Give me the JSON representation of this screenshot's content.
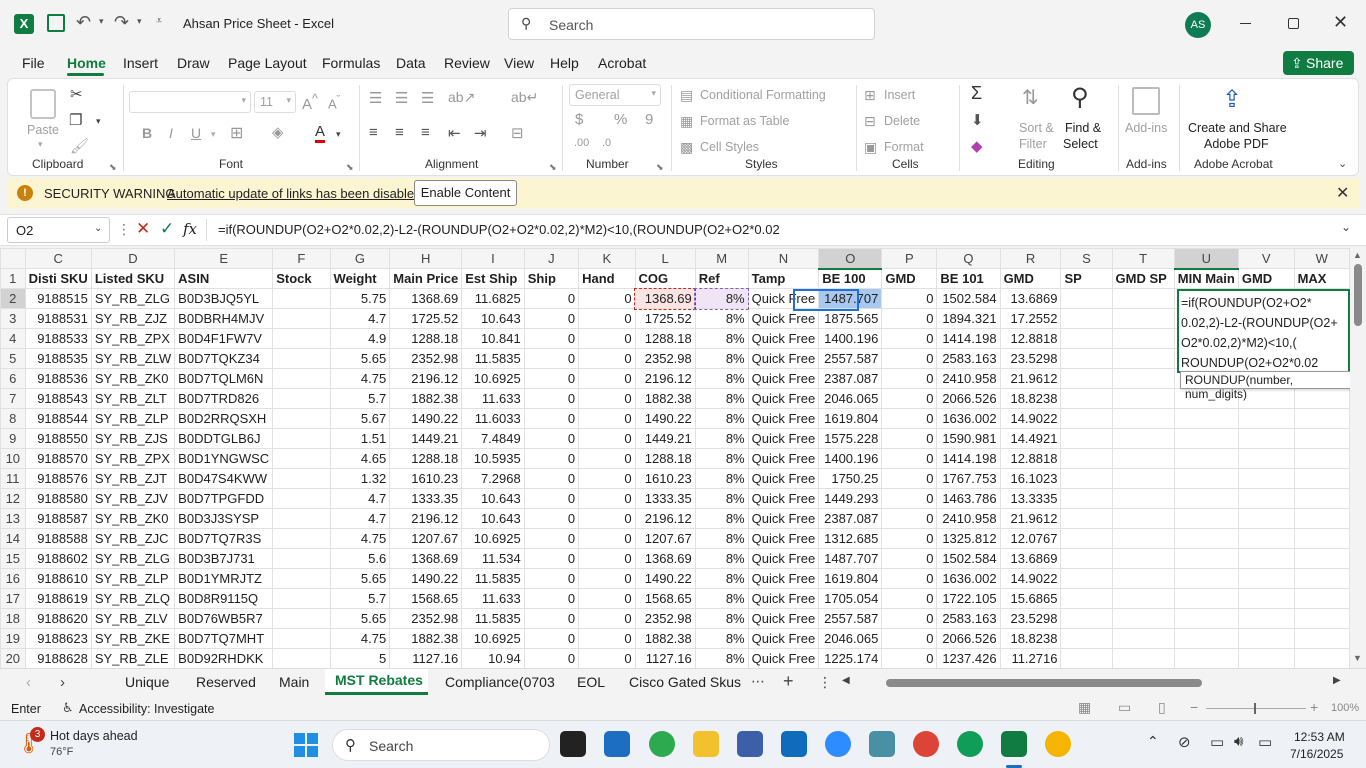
{
  "window": {
    "title": "Ahsan Price Sheet  -  Excel",
    "search_placeholder": "Search",
    "avatar": "AS"
  },
  "menu": [
    "File",
    "Home",
    "Insert",
    "Draw",
    "Page Layout",
    "Formulas",
    "Data",
    "Review",
    "View",
    "Help",
    "Acrobat"
  ],
  "share_label": "Share",
  "ribbon": {
    "clipboard": {
      "paste": "Paste",
      "group": "Clipboard"
    },
    "font": {
      "size": "11",
      "group": "Font"
    },
    "alignment": {
      "group": "Alignment"
    },
    "number": {
      "format": "General",
      "group": "Number"
    },
    "styles": {
      "cond": "Conditional Formatting",
      "table": "Format as Table",
      "cell": "Cell Styles",
      "group": "Styles"
    },
    "cells": {
      "insert": "Insert",
      "delete": "Delete",
      "format": "Format",
      "group": "Cells"
    },
    "editing": {
      "sort": "Sort &",
      "filter": "Filter",
      "find": "Find &",
      "select": "Select",
      "group": "Editing"
    },
    "addins": {
      "btn": "Add-ins",
      "group": "Add-ins"
    },
    "acrobat": {
      "line1": "Create and Share",
      "line2": "Adobe PDF",
      "group": "Adobe Acrobat"
    }
  },
  "security": {
    "label": "SECURITY WARNING",
    "message": "Automatic update of links has been disabled",
    "button": "Enable Content"
  },
  "formula_bar": {
    "name_box": "O2",
    "fx": "fx",
    "formula": "=if(ROUNDUP(O2+O2*0.02,2)-L2-(ROUNDUP(O2+O2*0.02,2)*M2)<10,(ROUNDUP(O2+O2*0.02"
  },
  "columns": [
    "C",
    "D",
    "E",
    "F",
    "G",
    "H",
    "I",
    "J",
    "K",
    "L",
    "M",
    "N",
    "O",
    "P",
    "Q",
    "R",
    "S",
    "T",
    "U",
    "V",
    "W"
  ],
  "headers": [
    "Disti SKU",
    "Listed SKU",
    "ASIN",
    "Stock",
    "Weight",
    "Main Price",
    "Est Ship",
    "Ship",
    "Hand",
    "COG",
    "Ref",
    "Tamp",
    "BE 100",
    "GMD",
    "BE 101",
    "GMD",
    "SP",
    "GMD SP",
    "MIN Main",
    "GMD",
    "MAX"
  ],
  "rows": [
    [
      "9188515",
      "SY_RB_ZLG",
      "B0D3BJQ5YL",
      "",
      "5.75",
      "1368.69",
      "11.6825",
      "0",
      "0",
      "1368.69",
      "8%",
      "Quick Free",
      "1487.707",
      "0",
      "1502.584",
      "13.6869",
      "",
      "",
      "",
      "",
      ""
    ],
    [
      "9188531",
      "SY_RB_ZJZ",
      "B0DBRH4MJV",
      "",
      "4.7",
      "1725.52",
      "10.643",
      "0",
      "0",
      "1725.52",
      "8%",
      "Quick Free",
      "1875.565",
      "0",
      "1894.321",
      "17.2552",
      "",
      "",
      "",
      "",
      ""
    ],
    [
      "9188533",
      "SY_RB_ZPX",
      "B0D4F1FW7V",
      "",
      "4.9",
      "1288.18",
      "10.841",
      "0",
      "0",
      "1288.18",
      "8%",
      "Quick Free",
      "1400.196",
      "0",
      "1414.198",
      "12.8818",
      "",
      "",
      "",
      "",
      ""
    ],
    [
      "9188535",
      "SY_RB_ZLW",
      "B0D7TQKZ34",
      "",
      "5.65",
      "2352.98",
      "11.5835",
      "0",
      "0",
      "2352.98",
      "8%",
      "Quick Free",
      "2557.587",
      "0",
      "2583.163",
      "23.5298",
      "",
      "",
      "",
      "",
      ""
    ],
    [
      "9188536",
      "SY_RB_ZK0",
      "B0D7TQLM6N",
      "",
      "4.75",
      "2196.12",
      "10.6925",
      "0",
      "0",
      "2196.12",
      "8%",
      "Quick Free",
      "2387.087",
      "0",
      "2410.958",
      "21.9612",
      "",
      "",
      "",
      "",
      ""
    ],
    [
      "9188543",
      "SY_RB_ZLT",
      "B0D7TRD826",
      "",
      "5.7",
      "1882.38",
      "11.633",
      "0",
      "0",
      "1882.38",
      "8%",
      "Quick Free",
      "2046.065",
      "0",
      "2066.526",
      "18.8238",
      "",
      "",
      "",
      "",
      ""
    ],
    [
      "9188544",
      "SY_RB_ZLP",
      "B0D2RRQSXH",
      "",
      "5.67",
      "1490.22",
      "11.6033",
      "0",
      "0",
      "1490.22",
      "8%",
      "Quick Free",
      "1619.804",
      "0",
      "1636.002",
      "14.9022",
      "",
      "",
      "",
      "",
      ""
    ],
    [
      "9188550",
      "SY_RB_ZJS",
      "B0DDTGLB6J",
      "",
      "1.51",
      "1449.21",
      "7.4849",
      "0",
      "0",
      "1449.21",
      "8%",
      "Quick Free",
      "1575.228",
      "0",
      "1590.981",
      "14.4921",
      "",
      "",
      "",
      "",
      ""
    ],
    [
      "9188570",
      "SY_RB_ZPX",
      "B0D1YNGWSC",
      "",
      "4.65",
      "1288.18",
      "10.5935",
      "0",
      "0",
      "1288.18",
      "8%",
      "Quick Free",
      "1400.196",
      "0",
      "1414.198",
      "12.8818",
      "",
      "",
      "",
      "",
      ""
    ],
    [
      "9188576",
      "SY_RB_ZJT",
      "B0D47S4KWW",
      "",
      "1.32",
      "1610.23",
      "7.2968",
      "0",
      "0",
      "1610.23",
      "8%",
      "Quick Free",
      "1750.25",
      "0",
      "1767.753",
      "16.1023",
      "",
      "",
      "",
      "",
      ""
    ],
    [
      "9188580",
      "SY_RB_ZJV",
      "B0D7TPGFDD",
      "",
      "4.7",
      "1333.35",
      "10.643",
      "0",
      "0",
      "1333.35",
      "8%",
      "Quick Free",
      "1449.293",
      "0",
      "1463.786",
      "13.3335",
      "",
      "",
      "",
      "",
      ""
    ],
    [
      "9188587",
      "SY_RB_ZK0",
      "B0D3J3SYSP",
      "",
      "4.7",
      "2196.12",
      "10.643",
      "0",
      "0",
      "2196.12",
      "8%",
      "Quick Free",
      "2387.087",
      "0",
      "2410.958",
      "21.9612",
      "",
      "",
      "",
      "",
      ""
    ],
    [
      "9188588",
      "SY_RB_ZJC",
      "B0D7TQ7R3S",
      "",
      "4.75",
      "1207.67",
      "10.6925",
      "0",
      "0",
      "1207.67",
      "8%",
      "Quick Free",
      "1312.685",
      "0",
      "1325.812",
      "12.0767",
      "",
      "",
      "",
      "",
      ""
    ],
    [
      "9188602",
      "SY_RB_ZLG",
      "B0D3B7J731",
      "",
      "5.6",
      "1368.69",
      "11.534",
      "0",
      "0",
      "1368.69",
      "8%",
      "Quick Free",
      "1487.707",
      "0",
      "1502.584",
      "13.6869",
      "",
      "",
      "",
      "",
      ""
    ],
    [
      "9188610",
      "SY_RB_ZLP",
      "B0D1YMRJTZ",
      "",
      "5.65",
      "1490.22",
      "11.5835",
      "0",
      "0",
      "1490.22",
      "8%",
      "Quick Free",
      "1619.804",
      "0",
      "1636.002",
      "14.9022",
      "",
      "",
      "",
      "",
      ""
    ],
    [
      "9188619",
      "SY_RB_ZLQ",
      "B0D8R9115Q",
      "",
      "5.7",
      "1568.65",
      "11.633",
      "0",
      "0",
      "1568.65",
      "8%",
      "Quick Free",
      "1705.054",
      "0",
      "1722.105",
      "15.6865",
      "",
      "",
      "",
      "",
      ""
    ],
    [
      "9188620",
      "SY_RB_ZLV",
      "B0D76WB5R7",
      "",
      "5.65",
      "2352.98",
      "11.5835",
      "0",
      "0",
      "2352.98",
      "8%",
      "Quick Free",
      "2557.587",
      "0",
      "2583.163",
      "23.5298",
      "",
      "",
      "",
      "",
      ""
    ],
    [
      "9188623",
      "SY_RB_ZKE",
      "B0D7TQ7MHT",
      "",
      "4.75",
      "1882.38",
      "10.6925",
      "0",
      "0",
      "1882.38",
      "8%",
      "Quick Free",
      "2046.065",
      "0",
      "2066.526",
      "18.8238",
      "",
      "",
      "",
      "",
      ""
    ],
    [
      "9188628",
      "SY_RB_ZLE",
      "B0D92RHDKK",
      "",
      "5",
      "1127.16",
      "10.94",
      "0",
      "0",
      "1127.16",
      "8%",
      "Quick Free",
      "1225.174",
      "0",
      "1237.426",
      "11.2716",
      "",
      "",
      "",
      "",
      ""
    ]
  ],
  "edit_overlay": {
    "lines": [
      "=if(ROUNDUP(O2+O2*",
      "0.02,2)-L2-(ROUNDUP(O2+",
      "O2*0.02,2)*M2)<10,(",
      "ROUNDUP(O2+O2*0.02"
    ],
    "tooltip": "ROUNDUP(number, num_digits)"
  },
  "sheets": [
    "Unique",
    "Reserved",
    "Main",
    "MST Rebates",
    "Compliance(0703",
    "EOL",
    "Cisco Gated Skus"
  ],
  "active_sheet": "MST Rebates",
  "status": {
    "mode": "Enter",
    "accessibility": "Accessibility: Investigate",
    "zoom": "100%"
  },
  "taskbar": {
    "weather_title": "Hot days ahead",
    "weather_temp": "76°F",
    "badge": "3",
    "search": "Search",
    "time": "12:53 AM",
    "date": "7/16/2025"
  },
  "colors": {
    "excel_green": "#107c41",
    "accent": "#185abd",
    "warning": "#fcf5d2"
  }
}
